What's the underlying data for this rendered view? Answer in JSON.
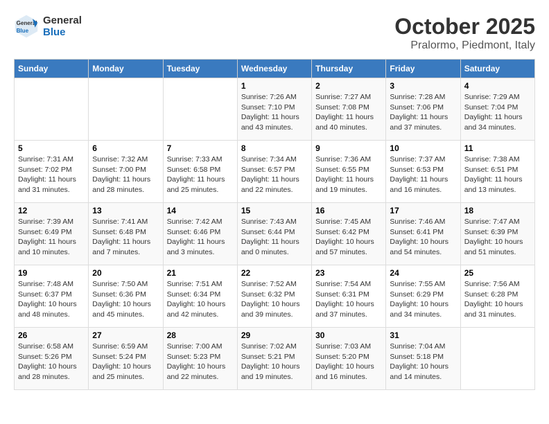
{
  "header": {
    "logo_line1": "General",
    "logo_line2": "Blue",
    "title": "October 2025",
    "subtitle": "Pralormo, Piedmont, Italy"
  },
  "weekdays": [
    "Sunday",
    "Monday",
    "Tuesday",
    "Wednesday",
    "Thursday",
    "Friday",
    "Saturday"
  ],
  "weeks": [
    [
      {
        "day": "",
        "info": ""
      },
      {
        "day": "",
        "info": ""
      },
      {
        "day": "",
        "info": ""
      },
      {
        "day": "1",
        "info": "Sunrise: 7:26 AM\nSunset: 7:10 PM\nDaylight: 11 hours\nand 43 minutes."
      },
      {
        "day": "2",
        "info": "Sunrise: 7:27 AM\nSunset: 7:08 PM\nDaylight: 11 hours\nand 40 minutes."
      },
      {
        "day": "3",
        "info": "Sunrise: 7:28 AM\nSunset: 7:06 PM\nDaylight: 11 hours\nand 37 minutes."
      },
      {
        "day": "4",
        "info": "Sunrise: 7:29 AM\nSunset: 7:04 PM\nDaylight: 11 hours\nand 34 minutes."
      }
    ],
    [
      {
        "day": "5",
        "info": "Sunrise: 7:31 AM\nSunset: 7:02 PM\nDaylight: 11 hours\nand 31 minutes."
      },
      {
        "day": "6",
        "info": "Sunrise: 7:32 AM\nSunset: 7:00 PM\nDaylight: 11 hours\nand 28 minutes."
      },
      {
        "day": "7",
        "info": "Sunrise: 7:33 AM\nSunset: 6:58 PM\nDaylight: 11 hours\nand 25 minutes."
      },
      {
        "day": "8",
        "info": "Sunrise: 7:34 AM\nSunset: 6:57 PM\nDaylight: 11 hours\nand 22 minutes."
      },
      {
        "day": "9",
        "info": "Sunrise: 7:36 AM\nSunset: 6:55 PM\nDaylight: 11 hours\nand 19 minutes."
      },
      {
        "day": "10",
        "info": "Sunrise: 7:37 AM\nSunset: 6:53 PM\nDaylight: 11 hours\nand 16 minutes."
      },
      {
        "day": "11",
        "info": "Sunrise: 7:38 AM\nSunset: 6:51 PM\nDaylight: 11 hours\nand 13 minutes."
      }
    ],
    [
      {
        "day": "12",
        "info": "Sunrise: 7:39 AM\nSunset: 6:49 PM\nDaylight: 11 hours\nand 10 minutes."
      },
      {
        "day": "13",
        "info": "Sunrise: 7:41 AM\nSunset: 6:48 PM\nDaylight: 11 hours\nand 7 minutes."
      },
      {
        "day": "14",
        "info": "Sunrise: 7:42 AM\nSunset: 6:46 PM\nDaylight: 11 hours\nand 3 minutes."
      },
      {
        "day": "15",
        "info": "Sunrise: 7:43 AM\nSunset: 6:44 PM\nDaylight: 11 hours\nand 0 minutes."
      },
      {
        "day": "16",
        "info": "Sunrise: 7:45 AM\nSunset: 6:42 PM\nDaylight: 10 hours\nand 57 minutes."
      },
      {
        "day": "17",
        "info": "Sunrise: 7:46 AM\nSunset: 6:41 PM\nDaylight: 10 hours\nand 54 minutes."
      },
      {
        "day": "18",
        "info": "Sunrise: 7:47 AM\nSunset: 6:39 PM\nDaylight: 10 hours\nand 51 minutes."
      }
    ],
    [
      {
        "day": "19",
        "info": "Sunrise: 7:48 AM\nSunset: 6:37 PM\nDaylight: 10 hours\nand 48 minutes."
      },
      {
        "day": "20",
        "info": "Sunrise: 7:50 AM\nSunset: 6:36 PM\nDaylight: 10 hours\nand 45 minutes."
      },
      {
        "day": "21",
        "info": "Sunrise: 7:51 AM\nSunset: 6:34 PM\nDaylight: 10 hours\nand 42 minutes."
      },
      {
        "day": "22",
        "info": "Sunrise: 7:52 AM\nSunset: 6:32 PM\nDaylight: 10 hours\nand 39 minutes."
      },
      {
        "day": "23",
        "info": "Sunrise: 7:54 AM\nSunset: 6:31 PM\nDaylight: 10 hours\nand 37 minutes."
      },
      {
        "day": "24",
        "info": "Sunrise: 7:55 AM\nSunset: 6:29 PM\nDaylight: 10 hours\nand 34 minutes."
      },
      {
        "day": "25",
        "info": "Sunrise: 7:56 AM\nSunset: 6:28 PM\nDaylight: 10 hours\nand 31 minutes."
      }
    ],
    [
      {
        "day": "26",
        "info": "Sunrise: 6:58 AM\nSunset: 5:26 PM\nDaylight: 10 hours\nand 28 minutes."
      },
      {
        "day": "27",
        "info": "Sunrise: 6:59 AM\nSunset: 5:24 PM\nDaylight: 10 hours\nand 25 minutes."
      },
      {
        "day": "28",
        "info": "Sunrise: 7:00 AM\nSunset: 5:23 PM\nDaylight: 10 hours\nand 22 minutes."
      },
      {
        "day": "29",
        "info": "Sunrise: 7:02 AM\nSunset: 5:21 PM\nDaylight: 10 hours\nand 19 minutes."
      },
      {
        "day": "30",
        "info": "Sunrise: 7:03 AM\nSunset: 5:20 PM\nDaylight: 10 hours\nand 16 minutes."
      },
      {
        "day": "31",
        "info": "Sunrise: 7:04 AM\nSunset: 5:18 PM\nDaylight: 10 hours\nand 14 minutes."
      },
      {
        "day": "",
        "info": ""
      }
    ]
  ]
}
